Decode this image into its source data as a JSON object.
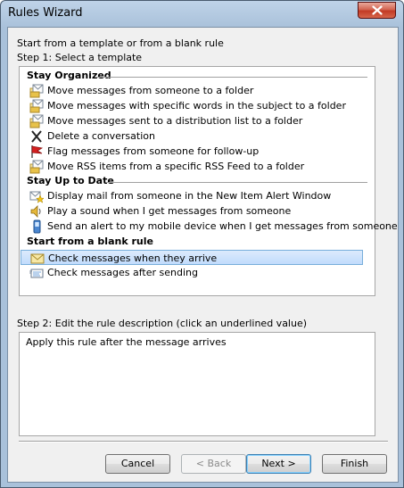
{
  "window": {
    "title": "Rules Wizard"
  },
  "intro_text": "Start from a template or from a blank rule",
  "step1_label": "Step 1: Select a template",
  "groups": [
    {
      "header": "Stay Organized",
      "items": [
        {
          "label": "Move messages from someone to a folder",
          "icon": "envelope-folder-icon"
        },
        {
          "label": "Move messages with specific words in the subject to a folder",
          "icon": "envelope-folder-icon"
        },
        {
          "label": "Move messages sent to a distribution list to a folder",
          "icon": "envelope-folder-icon"
        },
        {
          "label": "Delete a conversation",
          "icon": "delete-x-icon"
        },
        {
          "label": "Flag messages from someone for follow-up",
          "icon": "red-flag-icon"
        },
        {
          "label": "Move RSS items from a specific RSS Feed to a folder",
          "icon": "envelope-folder-icon"
        }
      ]
    },
    {
      "header": "Stay Up to Date",
      "items": [
        {
          "label": "Display mail from someone in the New Item Alert Window",
          "icon": "alert-star-icon"
        },
        {
          "label": "Play a sound when I get messages from someone",
          "icon": "speaker-icon"
        },
        {
          "label": "Send an alert to my mobile device when I get messages from someone",
          "icon": "mobile-phone-icon"
        }
      ]
    },
    {
      "header": "Start from a blank rule",
      "items": [
        {
          "label": "Check messages when they arrive",
          "icon": "envelope-icon",
          "selected": true
        },
        {
          "label": "Check messages after sending",
          "icon": "sent-mail-icon"
        }
      ]
    }
  ],
  "step2_label": "Step 2: Edit the rule description (click an underlined value)",
  "description": "Apply this rule after the message arrives",
  "buttons": {
    "cancel": "Cancel",
    "back": "< Back",
    "next": "Next >",
    "finish": "Finish"
  },
  "colors": {
    "selection": "#cce4f7",
    "flag": "#d42020",
    "frame": "#a9c1da"
  }
}
